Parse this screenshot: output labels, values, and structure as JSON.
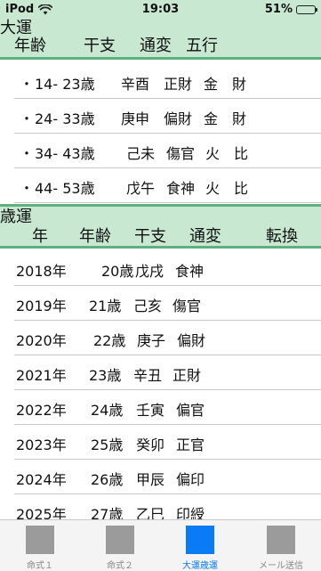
{
  "status_bar": {
    "device": "iPod",
    "time": "19:03",
    "battery": "51%",
    "battery_level": 0.51
  },
  "daiun": {
    "title": "大運",
    "columns": [
      "年齢",
      "干支",
      "通変",
      "五行"
    ],
    "rows": [
      {
        "bullet": "・",
        "age": "14- 23歳",
        "kanshi": "辛酉",
        "tsuhen": "正財",
        "gogyo": "金",
        "rel": "財"
      },
      {
        "bullet": "・",
        "age": "24- 33歳",
        "kanshi": "庚申",
        "tsuhen": "偏財",
        "gogyo": "金",
        "rel": "財"
      },
      {
        "bullet": "・",
        "age": "34- 43歳",
        "kanshi": "己未",
        "tsuhen": "傷官",
        "gogyo": "火",
        "rel": "比"
      },
      {
        "bullet": "・",
        "age": "44- 53歳",
        "kanshi": "戊午",
        "tsuhen": "食神",
        "gogyo": "火",
        "rel": "比"
      }
    ]
  },
  "saiun": {
    "title": "歳運",
    "columns": [
      "年",
      "年齢",
      "干支",
      "通変",
      "転換"
    ],
    "rows": [
      {
        "year": "2018年",
        "age": "20歳",
        "kanshi": "戊戌",
        "tsuhen": "食神"
      },
      {
        "year": "2019年",
        "age": "21歳",
        "kanshi": "己亥",
        "tsuhen": "傷官"
      },
      {
        "year": "2020年",
        "age": "22歳",
        "kanshi": "庚子",
        "tsuhen": "偏財"
      },
      {
        "year": "2021年",
        "age": "23歳",
        "kanshi": "辛丑",
        "tsuhen": "正財"
      },
      {
        "year": "2022年",
        "age": "24歳",
        "kanshi": "壬寅",
        "tsuhen": "偏官"
      },
      {
        "year": "2023年",
        "age": "25歳",
        "kanshi": "癸卯",
        "tsuhen": "正官"
      },
      {
        "year": "2024年",
        "age": "26歳",
        "kanshi": "甲辰",
        "tsuhen": "偏印"
      },
      {
        "year": "2025年",
        "age": "27歳",
        "kanshi": "乙巳",
        "tsuhen": "印綬"
      }
    ]
  },
  "tabs": [
    {
      "label": "命式１",
      "active": false
    },
    {
      "label": "命式２",
      "active": false
    },
    {
      "label": "大運歳運",
      "active": true
    },
    {
      "label": "メール送信",
      "active": false
    }
  ],
  "colors": {
    "header_bg": "#c8e8d2",
    "header_rule": "#5fb07f",
    "tab_active": "#0a7af5",
    "tab_inactive": "#9b9b9b"
  }
}
